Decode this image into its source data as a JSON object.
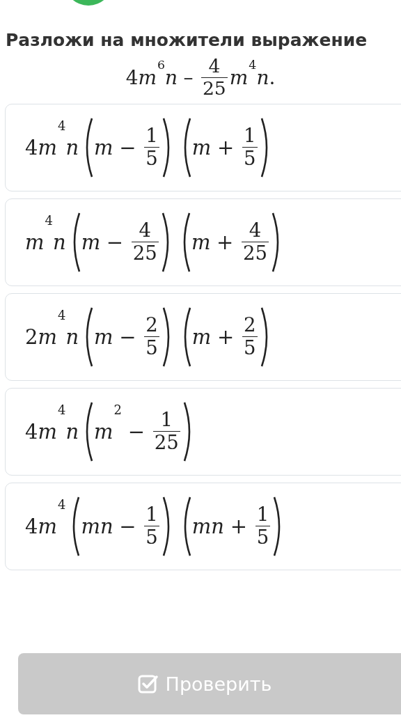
{
  "title": "Разложи на множители выражение",
  "expression": [
    {
      "kind": "num",
      "text": "4"
    },
    {
      "kind": "var",
      "text": "m"
    },
    {
      "kind": "sup",
      "text": "6"
    },
    {
      "kind": "var",
      "text": "n"
    },
    {
      "kind": "op",
      "text": "–"
    },
    {
      "kind": "frac",
      "num": "4",
      "den": "25"
    },
    {
      "kind": "var",
      "text": "m"
    },
    {
      "kind": "sup",
      "text": "4"
    },
    {
      "kind": "var",
      "text": "n"
    },
    {
      "kind": "num",
      "text": "."
    }
  ],
  "options": [
    {
      "selected": false,
      "items": [
        {
          "kind": "num",
          "text": "4"
        },
        {
          "kind": "var",
          "text": "m"
        },
        {
          "kind": "sup",
          "text": "4"
        },
        {
          "kind": "var",
          "text": "n"
        },
        {
          "kind": "group",
          "items": [
            {
              "kind": "var",
              "text": "m"
            },
            {
              "kind": "op",
              "text": "−"
            },
            {
              "kind": "frac",
              "num": "1",
              "den": "5"
            }
          ]
        },
        {
          "kind": "group",
          "items": [
            {
              "kind": "var",
              "text": "m"
            },
            {
              "kind": "op",
              "text": "+"
            },
            {
              "kind": "frac",
              "num": "1",
              "den": "5"
            }
          ]
        }
      ]
    },
    {
      "selected": false,
      "items": [
        {
          "kind": "var",
          "text": "m"
        },
        {
          "kind": "sup",
          "text": "4"
        },
        {
          "kind": "var",
          "text": "n"
        },
        {
          "kind": "group",
          "items": [
            {
              "kind": "var",
              "text": "m"
            },
            {
              "kind": "op",
              "text": "−"
            },
            {
              "kind": "frac",
              "num": "4",
              "den": "25"
            }
          ]
        },
        {
          "kind": "group",
          "items": [
            {
              "kind": "var",
              "text": "m"
            },
            {
              "kind": "op",
              "text": "+"
            },
            {
              "kind": "frac",
              "num": "4",
              "den": "25"
            }
          ]
        }
      ]
    },
    {
      "selected": false,
      "items": [
        {
          "kind": "num",
          "text": "2"
        },
        {
          "kind": "var",
          "text": "m"
        },
        {
          "kind": "sup",
          "text": "4"
        },
        {
          "kind": "var",
          "text": "n"
        },
        {
          "kind": "group",
          "items": [
            {
              "kind": "var",
              "text": "m"
            },
            {
              "kind": "op",
              "text": "−"
            },
            {
              "kind": "frac",
              "num": "2",
              "den": "5"
            }
          ]
        },
        {
          "kind": "group",
          "items": [
            {
              "kind": "var",
              "text": "m"
            },
            {
              "kind": "op",
              "text": "+"
            },
            {
              "kind": "frac",
              "num": "2",
              "den": "5"
            }
          ]
        }
      ]
    },
    {
      "selected": false,
      "items": [
        {
          "kind": "num",
          "text": "4"
        },
        {
          "kind": "var",
          "text": "m"
        },
        {
          "kind": "sup",
          "text": "4"
        },
        {
          "kind": "var",
          "text": "n"
        },
        {
          "kind": "group",
          "items": [
            {
              "kind": "var",
              "text": "m"
            },
            {
              "kind": "sup",
              "text": "2"
            },
            {
              "kind": "op",
              "text": "−"
            },
            {
              "kind": "frac",
              "num": "1",
              "den": "25"
            }
          ]
        }
      ]
    },
    {
      "selected": false,
      "items": [
        {
          "kind": "num",
          "text": "4"
        },
        {
          "kind": "var",
          "text": "m"
        },
        {
          "kind": "sup",
          "text": "4"
        },
        {
          "kind": "group",
          "items": [
            {
              "kind": "var",
              "text": "mn"
            },
            {
              "kind": "op",
              "text": "−"
            },
            {
              "kind": "frac",
              "num": "1",
              "den": "5"
            }
          ]
        },
        {
          "kind": "group",
          "items": [
            {
              "kind": "var",
              "text": "mn"
            },
            {
              "kind": "op",
              "text": "+"
            },
            {
              "kind": "frac",
              "num": "1",
              "den": "5"
            }
          ]
        }
      ]
    }
  ],
  "check_button": {
    "label": "Проверить",
    "disabled": true
  }
}
